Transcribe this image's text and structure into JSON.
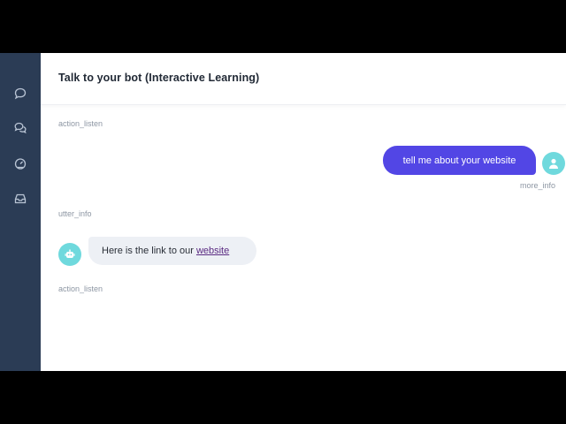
{
  "header": {
    "title": "Talk to your bot (Interactive Learning)"
  },
  "sidebar": {
    "icons": [
      "chat-bubble-icon",
      "conversations-icon",
      "dashboard-gauge-icon",
      "inbox-icon"
    ]
  },
  "conversation": {
    "events": [
      {
        "type": "action",
        "text": "action_listen"
      },
      {
        "type": "user",
        "text": "tell me about your website",
        "intent": "more_info"
      },
      {
        "type": "action",
        "text": "utter_info"
      },
      {
        "type": "bot",
        "text": "Here is the link to our",
        "link": "website"
      },
      {
        "type": "action",
        "text": "action_listen"
      }
    ]
  },
  "colors": {
    "sidebar": "#2b3c55",
    "user_bubble": "#5246e5",
    "avatar": "#6fd9dd",
    "bot_bubble": "#edf0f5"
  }
}
